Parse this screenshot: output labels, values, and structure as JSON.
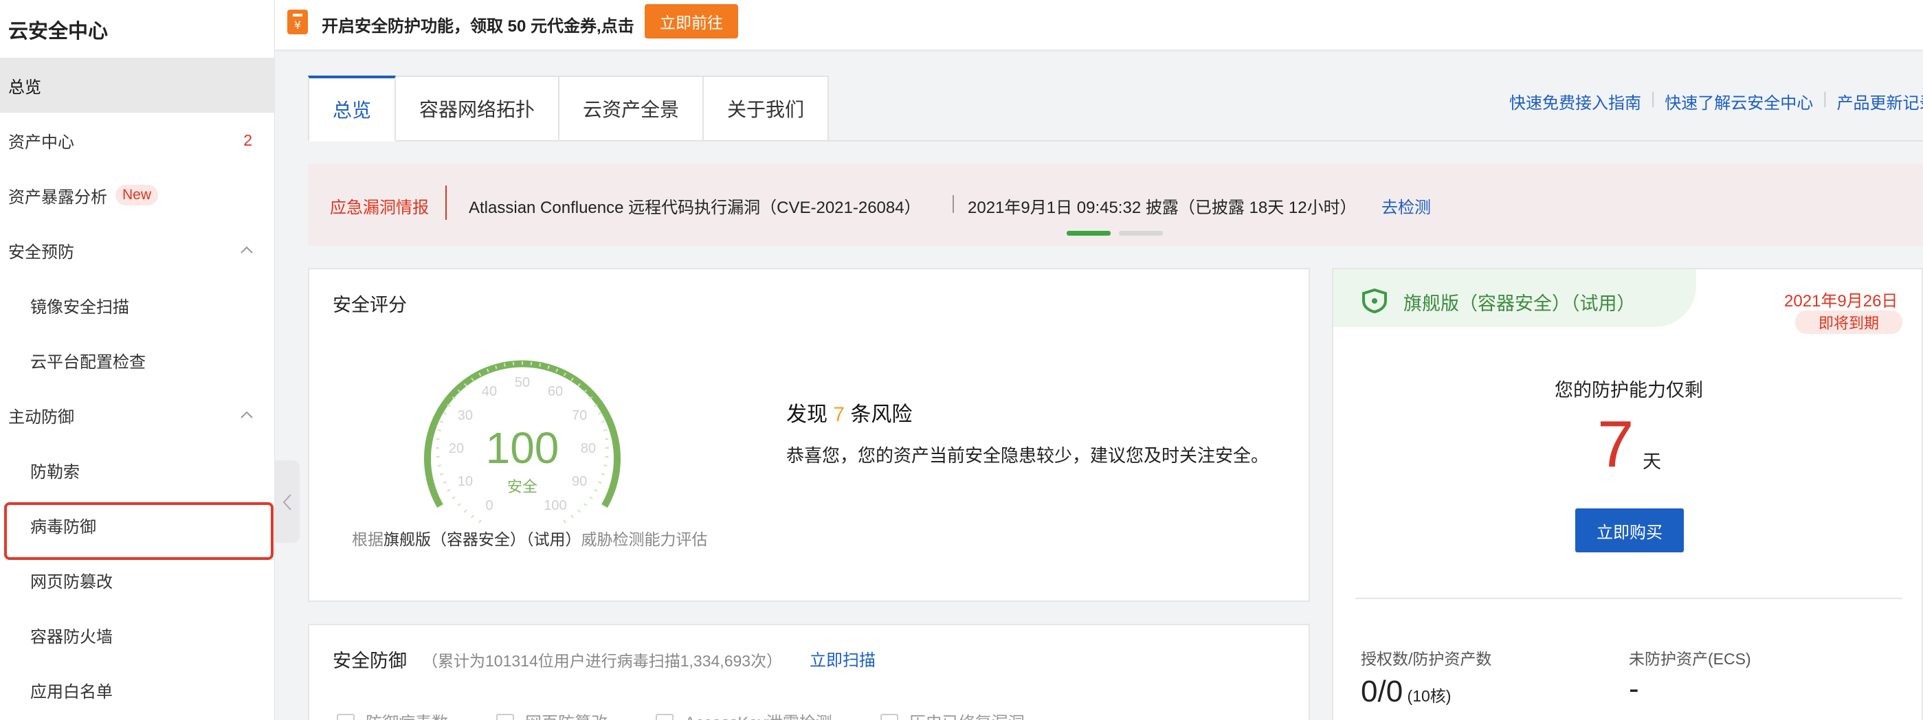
{
  "sidebar": {
    "title": "云安全中心",
    "items": [
      {
        "label": "总览"
      },
      {
        "label": "资产中心",
        "count": "2"
      },
      {
        "label": "资产暴露分析",
        "badge": "New"
      },
      {
        "label": "安全预防"
      },
      {
        "label": "镜像安全扫描"
      },
      {
        "label": "云平台配置检查"
      },
      {
        "label": "主动防御"
      },
      {
        "label": "防勒索"
      },
      {
        "label": "病毒防御"
      },
      {
        "label": "网页防篡改"
      },
      {
        "label": "容器防火墙"
      },
      {
        "label": "应用白名单"
      }
    ]
  },
  "banner": {
    "message": "开启安全防护功能，领取 50 元代金券,点击",
    "button": "立即前往"
  },
  "tabs": [
    "总览",
    "容器网络拓扑",
    "云资产全景",
    "关于我们"
  ],
  "top_links": [
    "快速免费接入指南",
    "快速了解云安全中心",
    "产品更新记录"
  ],
  "alert": {
    "tag": "应急漏洞情报",
    "title": "Atlassian Confluence 远程代码执行漏洞（CVE-2021-26084）",
    "time": "2021年9月1日 09:45:32 披露（已披露 18天 12小时）",
    "action": "去检测"
  },
  "score": {
    "title": "安全评分",
    "value": "100",
    "status": "安全",
    "ticks": [
      "0",
      "10",
      "20",
      "30",
      "40",
      "50",
      "60",
      "70",
      "80",
      "90",
      "100"
    ],
    "risk_prefix": "发现 ",
    "risk_count": "7",
    "risk_suffix": " 条风险",
    "description": "恭喜您，您的资产当前安全隐患较少，建议您及时关注安全。",
    "eval_prefix": "根据",
    "eval_edition": "旗舰版（容器安全）（试用）",
    "eval_suffix": "威胁检测能力评估",
    "gauge_color": "#7bb35b"
  },
  "defense": {
    "title": "安全防御",
    "subtitle": "（累计为101314位用户进行病毒扫描1,334,693次）",
    "scan": "立即扫描",
    "items": [
      "防御病毒数",
      "网页防篡改",
      "AccessKey泄露检测",
      "历史已修复漏洞"
    ]
  },
  "edition": {
    "name": "旗舰版（容器安全）（试用）",
    "date": "2021年9月26日",
    "status": "即将到期",
    "remain_label": "您的防护能力仅剩",
    "remain_days": "7",
    "remain_unit": "天",
    "buy": "立即购买",
    "auth_label": "授权数/防护资产数",
    "auth_value": "0/0",
    "auth_cores": " (10核)",
    "unprotected_label": "未防护资产(ECS)",
    "unprotected_value": "-"
  }
}
